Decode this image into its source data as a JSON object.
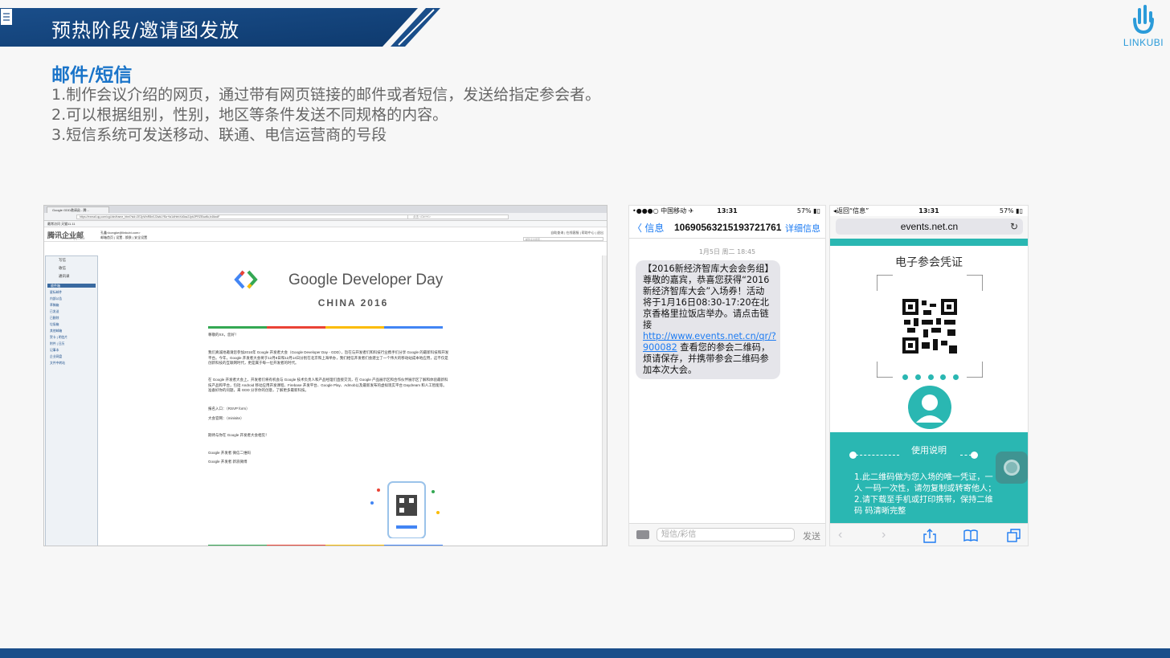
{
  "header": {
    "title": "预热阶段/邀请函发放",
    "accent": "#1a4e8a"
  },
  "logo": {
    "text": "LINKUBI",
    "color": "#2b9bd9"
  },
  "section": {
    "title": "邮件/短信",
    "lines": [
      "1.制作会议介绍的网页，通过带有网页链接的邮件或者短信，发送给指定参会者。",
      "2.可以根据组别，性别，地区等条件发送不同规格的内容。",
      "3.短信系统可发送移动、联通、电信运营商的号段"
    ]
  },
  "browser": {
    "tab_label": "Google GDD邀请函 - 腾...",
    "url": "https://exmail.qq.com/cgi-bin/frame_html?sid=2E2pWnR8n0J2wkLYBz+fa1dHebXd0az2Jpb2PRZEkw8c,b4lkxdF",
    "search_placeholder": "点击 <Ctrl+K>",
    "bookmarks": "最常访问  天猫11.11",
    "mail_logo": "腾讯企业邮",
    "mail_logo_sub": "EXMAIL.QQ.COM",
    "mail_user": "孔鑫<kongke@linkubi.com>",
    "mail_user_links": "邮箱首页 | 设置 - 换肤 | 安全设置",
    "top_links": "自助查询 | 在线客服 | 帮助中心 | 退出",
    "mail_search": "邮件全文搜索...",
    "sidebar": {
      "buttons": [
        "写信",
        "收信",
        "通讯录"
      ],
      "selected": "收件箱",
      "items": [
        "星标邮件",
        "内部公告",
        "草稿箱",
        "已发送",
        "已删除",
        "垃圾箱",
        "其他邮箱",
        "贺卡 | 明信片",
        "附件 | 日历",
        "记事本",
        "企业网盘",
        "文件中转站"
      ]
    },
    "email": {
      "brand": "Google Developer Day",
      "subtitle": "CHINA 2016",
      "greeting": "尊敬的XX，您好！",
      "para1": "我们真诚地邀请您参加2016年 Google 开发者大会（Google Developer Day - GDD），旨在与开发者们和科技行业携手们分享 Google 的最新科技和开发平台。今年，Google 开发者大会将于12月8日和12月14日分别在北京和上海举办，我们相信开发者们会建立了一个伟大的移动站成本地应用，这不仅是创新科技的互联网时代，更是属于每一位开发者的时代。",
      "para2": "在 Google 开发者大会上，开发者们将有机会与 Google 技术负责人和产品经理们直接交流，在 Google 产品展示区和合作伙伴展示区了解和体验最新科技产品和平台，包括 Android 移动应用开发课程、Firebase 开发平台、Google Play、Admob以及最新发布的虚拟现实平台 Daydream 和人工智能等。准备好你的问题，来 GDD 分享你的创意，了解更多最新科技。",
      "rsvp": "报名入口：（RSVP form）",
      "site": "大会官网：（minisite）",
      "closing": "期待与你在 Google 开发者大会相见！",
      "wechat": "Google 开发者 微信二维码",
      "weibo": "Google 开发者 新浪微博"
    },
    "colors": {
      "blue": "#4285f4",
      "green": "#34a853",
      "yellow": "#fbbc05",
      "red": "#ea4335"
    }
  },
  "sms": {
    "status_left": "•●●●○ 中国移动 ✈",
    "status_time": "13:31",
    "status_right": "57% ▮▯",
    "back": "〈 信息",
    "number": "10690563215193721761",
    "detail": "详细信息",
    "date": "1月5日 周二 18:45",
    "message_before": "【2016新经济智库大会会务组】尊敬的嘉宾，恭喜您获得“2016新经济智库大会”入场券！活动将于1月16日08:30-17:20在北京香格里拉饭店举办。请点击链接",
    "message_link": "http://www.events.net.cn/qr/?900082",
    "message_after": "查看您的参会二维码，烦请保存，并携带参会二维码参加本次大会。",
    "input_placeholder": "短信/彩信",
    "send": "发送"
  },
  "events": {
    "status_left": "◂返回“信息”",
    "status_time": "13:31",
    "status_right": "57% ▮▯",
    "url": "events.net.cn",
    "title": "电子参会凭证",
    "usage_title": "使用说明",
    "usage_lines": [
      "1.此二维码做为您入场的唯一凭证，一",
      "人 一码一次性，请勿复制或转寄他人；",
      "2.请下载至手机或打印携带，保持二维",
      "码 码清晰完整"
    ],
    "accent": "#2ab7b2"
  }
}
